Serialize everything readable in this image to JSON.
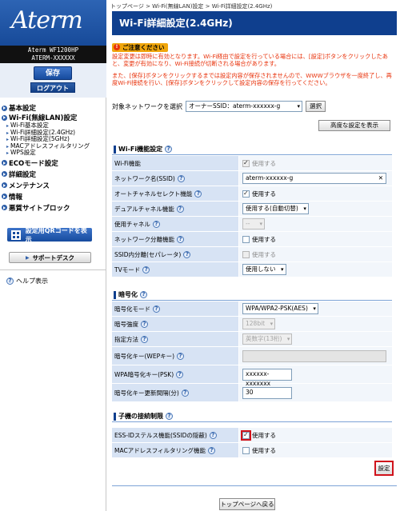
{
  "brand": {
    "logo_text": "Aterm",
    "model_line1": "Aterm WF1200HP",
    "model_line2": "ATERM-XXXXXX"
  },
  "sidebar": {
    "save_label": "保存",
    "logout_label": "ログアウト",
    "nav": [
      {
        "label": "基本設定",
        "subs": []
      },
      {
        "label": "Wi-Fi(無線LAN)設定",
        "subs": [
          "Wi-Fi基本設定",
          "Wi-Fi詳細設定(2.4GHz)",
          "Wi-Fi詳細設定(5GHz)",
          "MACアドレスフィルタリング",
          "WPS設定"
        ]
      },
      {
        "label": "ECOモード設定",
        "subs": []
      },
      {
        "label": "詳細設定",
        "subs": []
      },
      {
        "label": "メンテナンス",
        "subs": []
      },
      {
        "label": "情報",
        "subs": []
      },
      {
        "label": "悪質サイトブロック",
        "subs": []
      }
    ],
    "qr_label": "設定用QRコードを表示",
    "support_label": "サポートデスク",
    "help_label": "ヘルプ表示"
  },
  "breadcrumb": "トップページ > Wi-Fi(無線LAN)設定 > Wi-Fi詳細設定(2.4GHz)",
  "page_title": "Wi-Fi詳細設定(2.4GHz)",
  "notice": {
    "badge": "ご注意ください",
    "p1": "設定変更は即時に有効となります。Wi-Fi経由で設定を行っている場合には、[設定]ボタンをクリックしたあと、変更が有効になり、Wi-Fi接続が切断される場合があります。",
    "p2": "また、[保存]ボタンをクリックするまでは設定内容が保存されませんので、WWWブラウザを一度終了し、再度Wi-Fi接続を行い、[保存]ボタンをクリックして設定内容の保存を行ってください。"
  },
  "target": {
    "label": "対象ネットワークを選択",
    "value": "オーナーSSID：aterm-xxxxxx-g",
    "button": "選択"
  },
  "advanced_button": "高度な設定を表示",
  "wifi_section": {
    "title": "Wi-Fi機能設定",
    "rows": [
      {
        "label": "Wi-Fi機能",
        "value": "使用する"
      },
      {
        "label": "ネットワーク名(SSID)",
        "value": "aterm-xxxxxx-g"
      },
      {
        "label": "オートチャネルセレクト機能",
        "value": "使用する"
      },
      {
        "label": "デュアルチャネル機能",
        "value": "使用する(自動切替)"
      },
      {
        "label": "使用チャネル",
        "value": "--"
      },
      {
        "label": "ネットワーク分離機能",
        "value": "使用する"
      },
      {
        "label": "SSID内分離(セパレータ)",
        "value": "使用する"
      },
      {
        "label": "TVモード",
        "value": "使用しない"
      }
    ]
  },
  "enc_section": {
    "title": "暗号化",
    "rows": [
      {
        "label": "暗号化モード",
        "value": "WPA/WPA2-PSK(AES)"
      },
      {
        "label": "暗号強度",
        "value": "128bit"
      },
      {
        "label": "指定方法",
        "value": "英数字(13桁)"
      },
      {
        "label": "暗号化キー(WEPキー)",
        "value": ""
      },
      {
        "label": "WPA暗号化キー(PSK)",
        "value": "xxxxxx-xxxxxxx"
      },
      {
        "label": "暗号化キー更新間隔(分)",
        "value": "30"
      }
    ]
  },
  "conn_section": {
    "title": "子機の接続制限",
    "rows": [
      {
        "label": "ESS-IDステルス機能(SSIDの隠蔽)",
        "value": "使用する"
      },
      {
        "label": "MACアドレスフィルタリング機能",
        "value": "使用する"
      }
    ]
  },
  "set_button": "設定",
  "top_button": "トップページへ戻る",
  "colors": {
    "title_bar": "#0f3f8e",
    "notice_red": "#e8310a",
    "highlight": "#d0121b"
  }
}
